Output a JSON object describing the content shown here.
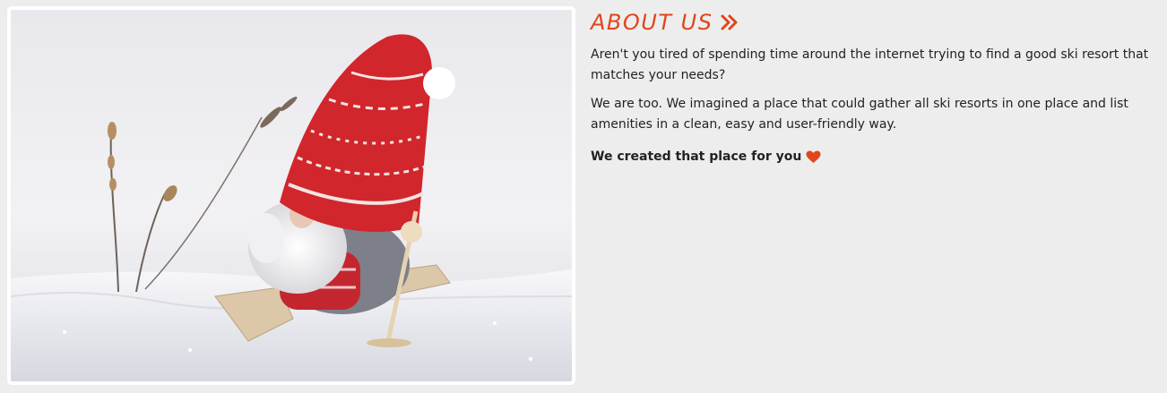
{
  "about": {
    "title": "ABOUT US",
    "paragraphs": [
      "Aren't you tired of spending time around the internet trying to find a good ski resort that matches your needs?",
      "We are too. We imagined a place that could gather all ski resorts in one place and list amenities in a clean, easy and user-friendly way."
    ],
    "closing": "We created that place for you"
  },
  "icons": {
    "title_icon": "double-chevron-right-icon",
    "closing_icon": "heart-icon"
  },
  "colors": {
    "accent": "#e1451c",
    "background": "#ededed",
    "text": "#222222"
  }
}
